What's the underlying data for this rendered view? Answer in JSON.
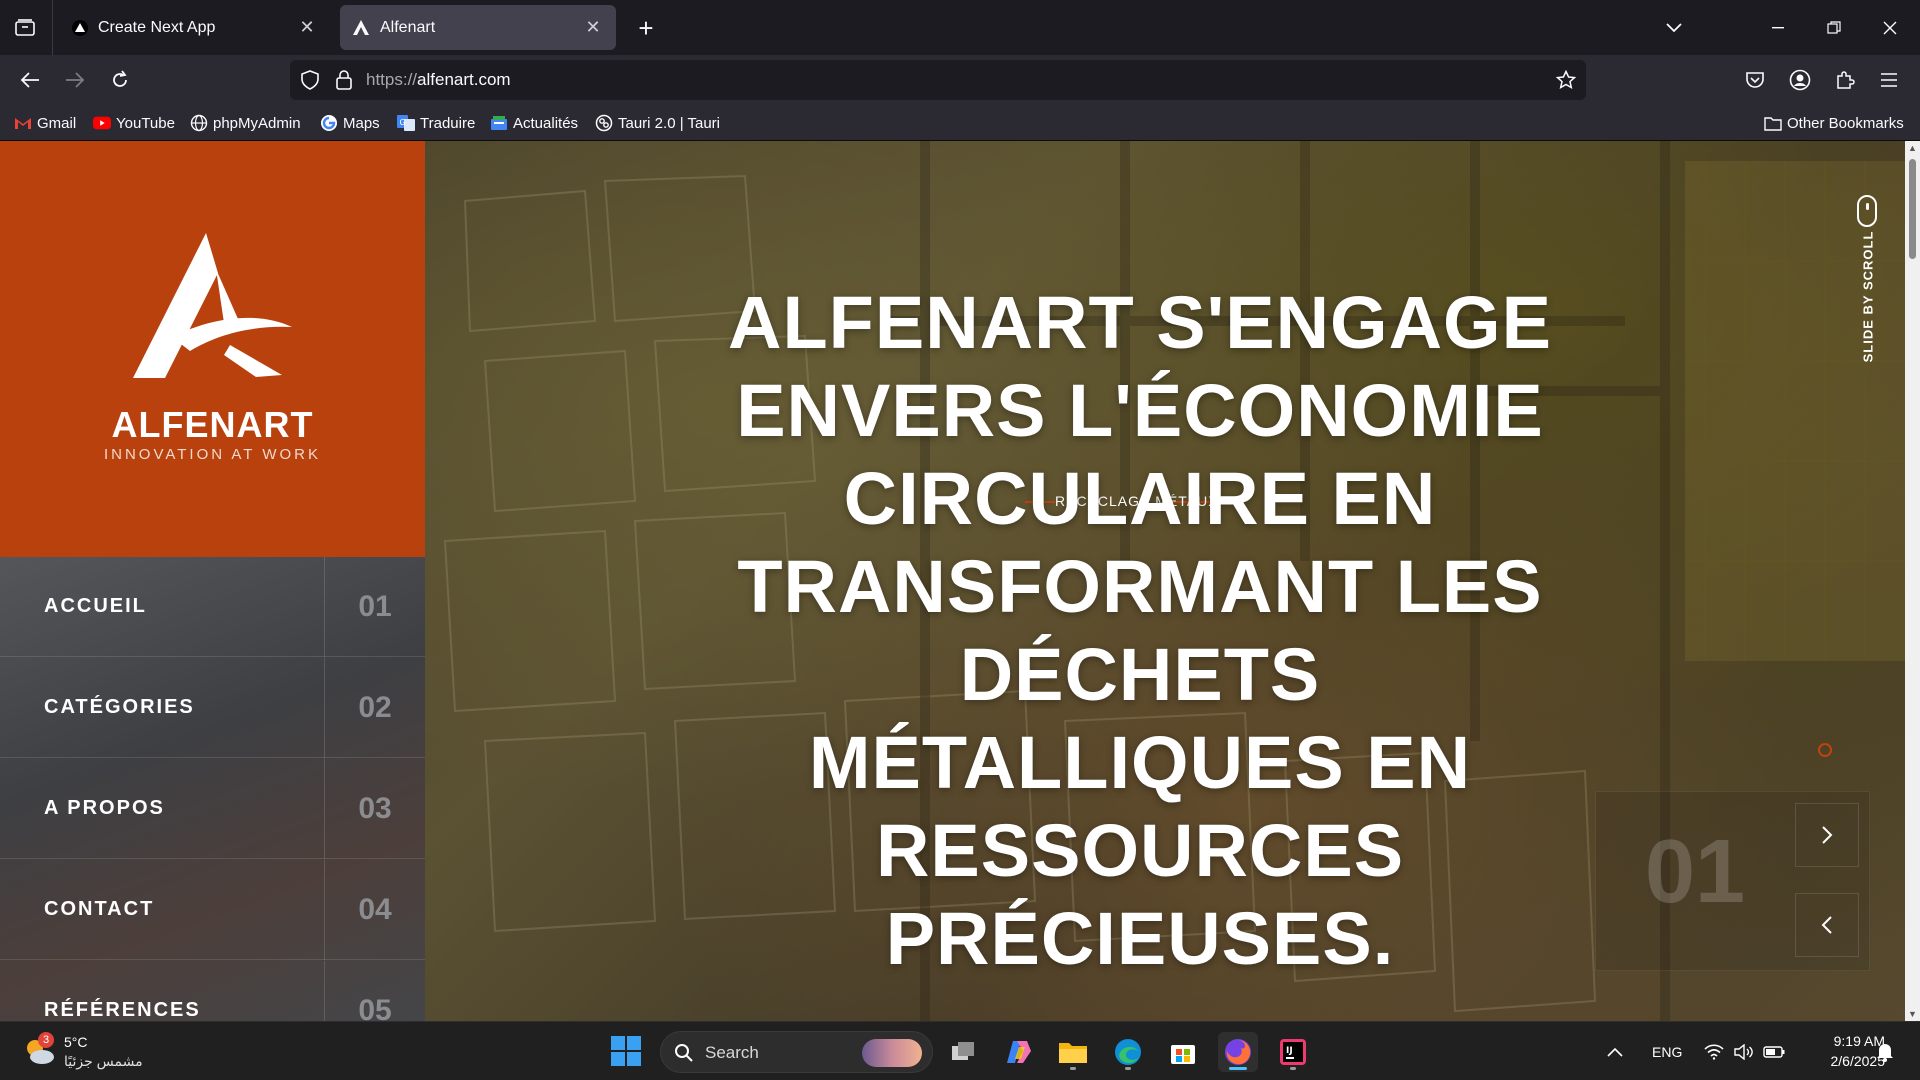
{
  "browser": {
    "tabs": [
      {
        "title": "Create Next App",
        "active": false,
        "icon": "nextjs-triangle-icon"
      },
      {
        "title": "Alfenart",
        "active": true,
        "icon": "alfenart-icon"
      }
    ],
    "url": {
      "scheme": "https://",
      "host": "alfenart.com"
    },
    "bookmarks": [
      {
        "label": "Gmail",
        "icon": "gmail-icon"
      },
      {
        "label": "YouTube",
        "icon": "youtube-icon"
      },
      {
        "label": "phpMyAdmin",
        "icon": "globe-icon"
      },
      {
        "label": "Maps",
        "icon": "google-icon"
      },
      {
        "label": "Traduire",
        "icon": "translate-icon"
      },
      {
        "label": "Actualités",
        "icon": "news-icon"
      },
      {
        "label": "Tauri 2.0 | Tauri",
        "icon": "tauri-icon"
      }
    ],
    "other_bookmarks": "Other Bookmarks"
  },
  "site": {
    "brand": {
      "name": "ALFENART",
      "tagline": "INNOVATION AT WORK",
      "color": "#b8410e"
    },
    "menu": [
      {
        "label": "ACCUEIL",
        "number": "01"
      },
      {
        "label": "CATÉGORIES",
        "number": "02"
      },
      {
        "label": "A PROPOS",
        "number": "03"
      },
      {
        "label": "CONTACT",
        "number": "04"
      },
      {
        "label": "RÉFÉRENCES",
        "number": "05"
      }
    ],
    "hero": {
      "title": "ALFENART S'ENGAGE ENVERS L'ÉCONOMIE CIRCULAIRE EN TRANSFORMANT LES DÉCHETS MÉTALLIQUES EN RESSOURCES PRÉCIEUSES.",
      "subtitle": "RECYCLAGE MÉTAUX",
      "scroll_hint": "SLIDE BY SCROLL",
      "slide_number": "01",
      "accent": "#c2410c"
    }
  },
  "taskbar": {
    "weather": {
      "temp": "5°C",
      "desc": "مشمس جزئيًا",
      "badge": "3"
    },
    "search_label": "Search",
    "language": "ENG",
    "time": "9:19 AM",
    "date": "2/6/2025"
  }
}
